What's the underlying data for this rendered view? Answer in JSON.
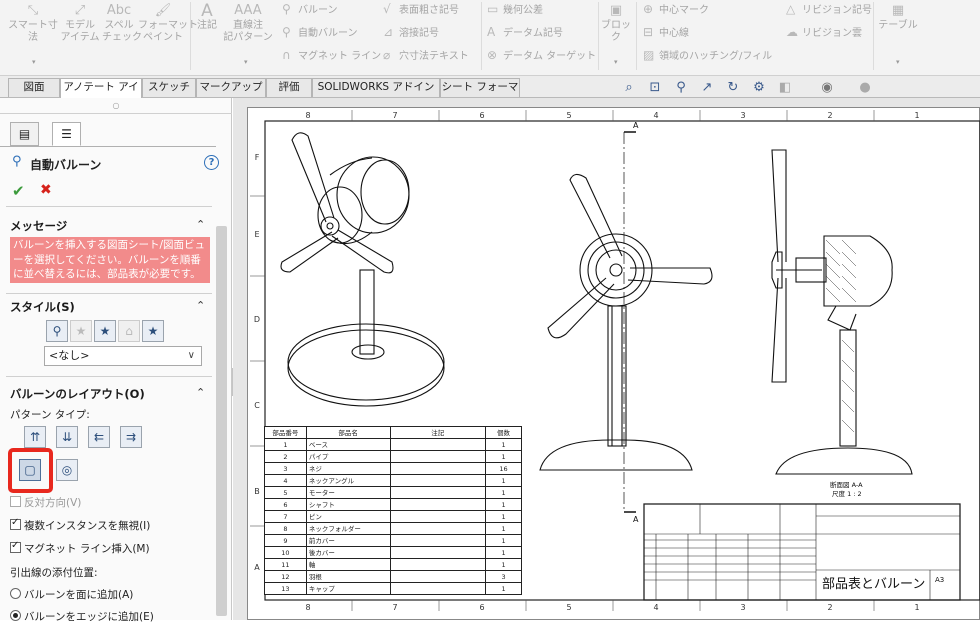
{
  "ribbon": {
    "smart_dim": "スマート寸\n法",
    "model_items": "モデル\nアイテム",
    "spell_check": "スペル\nチェック",
    "format_painter": "フォーマット\nペイント",
    "note": "注記",
    "linear_note_pattern": "直線注\n記パターン",
    "balloon": "バルーン",
    "auto_balloon": "自動バルーン",
    "magnetic_line": "マグネット ライン",
    "surface_finish": "表面粗さ記号",
    "weld_symbol": "溶接記号",
    "hole_callout": "穴寸法テキスト",
    "gtol": "幾何公差",
    "datum_feature": "データム記号",
    "datum_target": "データム ターゲット",
    "block": "ブロック",
    "center_mark": "中心マーク",
    "centerline": "中心線",
    "area_hatch": "領域のハッチング/フィル",
    "revision_symbol": "リビジョン記号",
    "revision_cloud": "リビジョン雲",
    "table": "テーブル"
  },
  "tabs": [
    "図面",
    "アノテート アイテム",
    "スケッチ",
    "マークアップ",
    "評価",
    "SOLIDWORKS アドイン",
    "シート フォーマット"
  ],
  "active_tab": "アノテート アイテム",
  "panel": {
    "title": "自動バルーン",
    "ok_label": "✔",
    "cancel_label": "✖",
    "message_section": "メッセージ",
    "message_text": "バルーンを挿入する図面シート/図面ビューを選択してください。バルーンを順番に並べ替えるには、部品表が必要です。",
    "style_section": "スタイル(S)",
    "style_value": "<なし>",
    "layout_section": "バルーンのレイアウト(O)",
    "pattern_type_label": "パターン タイプ:",
    "reverse_direction": "反対方向(V)",
    "ignore_multiple": "複数インスタンスを無視(I)",
    "insert_magnetic": "マグネット ライン挿入(M)",
    "leader_attach_label": "引出線の添付位置:",
    "attach_faces": "バルーンを面に追加(A)",
    "attach_edges": "バルーンをエッジに追加(E)"
  },
  "sheet": {
    "columns": [
      "8",
      "7",
      "6",
      "5",
      "4",
      "3",
      "2",
      "1"
    ],
    "rows": [
      "F",
      "E",
      "D",
      "C",
      "B",
      "A"
    ],
    "section_marker": "A",
    "section_label": "断面図 A-A",
    "section_scale": "尺度 1 : 2",
    "title_text": "部品表とバルーン",
    "sheet_size": "A3"
  },
  "bom": {
    "headers": [
      "部品番号",
      "部品名",
      "注記",
      "個数"
    ],
    "rows": [
      [
        "1",
        "ベース",
        "",
        "1"
      ],
      [
        "2",
        "パイプ",
        "",
        "1"
      ],
      [
        "3",
        "ネジ",
        "",
        "16"
      ],
      [
        "4",
        "ネックアングル",
        "",
        "1"
      ],
      [
        "5",
        "モーター",
        "",
        "1"
      ],
      [
        "6",
        "シャフト",
        "",
        "1"
      ],
      [
        "7",
        "ピン",
        "",
        "1"
      ],
      [
        "8",
        "ネックフォルダー",
        "",
        "1"
      ],
      [
        "9",
        "前カバー",
        "",
        "1"
      ],
      [
        "10",
        "後カバー",
        "",
        "1"
      ],
      [
        "11",
        "軸",
        "",
        "1"
      ],
      [
        "12",
        "羽根",
        "",
        "3"
      ],
      [
        "13",
        "キャップ",
        "",
        "1"
      ]
    ]
  },
  "colors": {
    "message_bg": "#f28b8b",
    "highlight": "#e8281e",
    "accent_icon": "#2d6fb8",
    "ok_green": "#3c9b3c",
    "cancel_red": "#d6221b"
  }
}
